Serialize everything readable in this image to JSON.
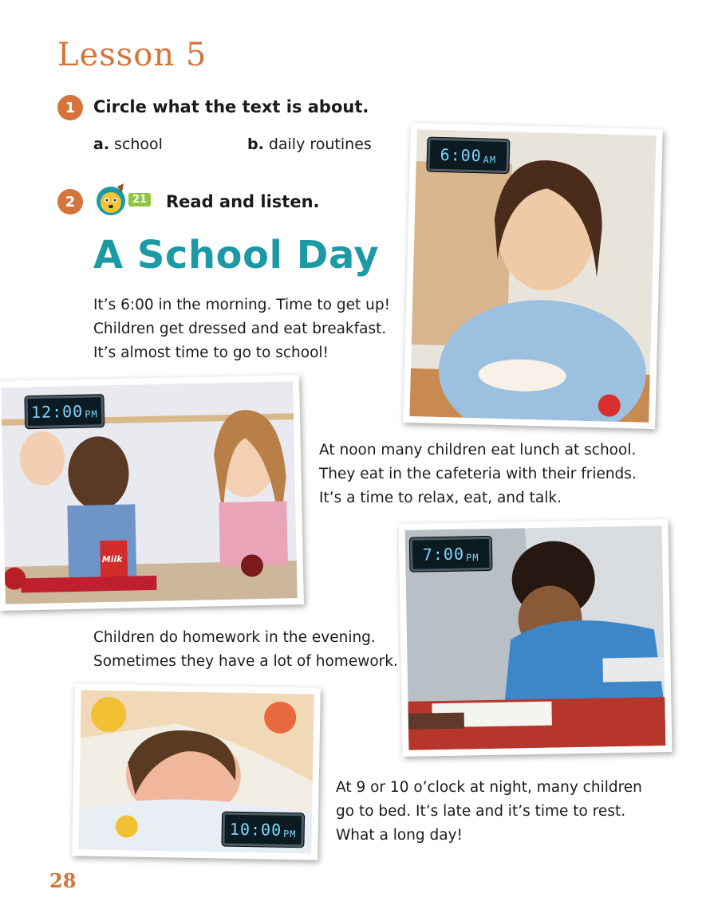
{
  "lesson": {
    "title": "Lesson 5"
  },
  "activity1": {
    "number": "1",
    "instruction": "Circle what the text is about.",
    "option_a_letter": "a.",
    "option_a": "school",
    "option_b_letter": "b.",
    "option_b": "daily routines"
  },
  "activity2": {
    "number": "2",
    "track": "21",
    "instruction": "Read and listen."
  },
  "story": {
    "title": "A School Day",
    "p1": "It’s 6:00 in the morning. Time to get up!\nChildren get dressed and eat breakfast.\nIt’s almost time to go to school!",
    "p2": "At noon many children eat lunch at school.\nThey eat in the cafeteria with their friends.\nIt’s a time to relax, eat, and talk.",
    "p3": "Children do homework in the evening.\nSometimes they have a lot of homework.",
    "p4": "At 9 or 10 o’clock at night, many children\ngo to bed. It’s late and it’s time to rest.\nWhat a long day!"
  },
  "clocks": {
    "c1_time": "6:00",
    "c1_ampm": "AM",
    "c2_time": "12:00",
    "c2_ampm": "PM",
    "c3_time": "7:00",
    "c3_ampm": "PM",
    "c4_time": "10:00",
    "c4_ampm": "PM"
  },
  "photo_text": {
    "milk_label": "Milk"
  },
  "page_number": "28",
  "colors": {
    "accent_orange": "#d4743a",
    "title_teal": "#1b9aa6",
    "track_green": "#8bc63f"
  },
  "icons": {
    "audio": "dog-mascot-audio-icon"
  }
}
